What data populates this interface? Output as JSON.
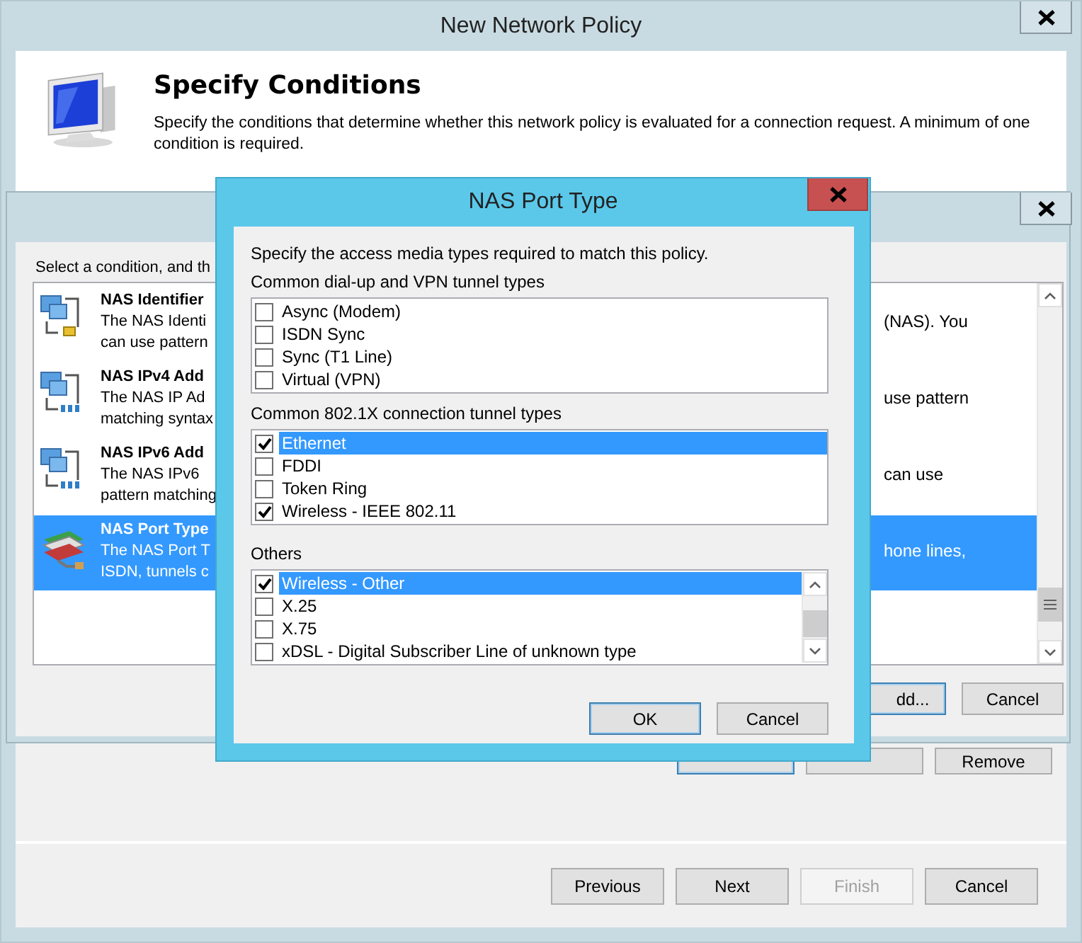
{
  "main_window": {
    "title": "New Network Policy",
    "heading": "Specify Conditions",
    "description": "Specify the conditions that determine whether this network policy is evaluated for a connection request. A minimum of one condition is required.",
    "condition_buttons": [
      {
        "disabled": false
      },
      {
        "disabled": false
      },
      {
        "label": "Remove",
        "disabled": false
      }
    ],
    "nav_buttons": [
      {
        "label": "Previous",
        "disabled": false
      },
      {
        "label": "Next",
        "disabled": false
      },
      {
        "label": "Finish",
        "disabled": true
      },
      {
        "label": "Cancel",
        "disabled": false
      }
    ]
  },
  "condition_window": {
    "prompt": "Select a condition, and th",
    "conditions": [
      {
        "title": "NAS Identifier",
        "lines": [
          "The NAS Identi",
          "can use pattern"
        ],
        "tail": "(NAS). You",
        "selected": false
      },
      {
        "title": "NAS IPv4 Add",
        "lines": [
          "The NAS IP Ad",
          "matching syntax"
        ],
        "tail": "use pattern",
        "selected": false
      },
      {
        "title": "NAS IPv6 Add",
        "lines": [
          "The NAS IPv6",
          "pattern matching"
        ],
        "tail": "can use",
        "selected": false
      },
      {
        "title": "NAS Port Type",
        "lines": [
          "The NAS Port T",
          "ISDN, tunnels c"
        ],
        "tail": "hone lines,",
        "selected": true
      }
    ],
    "buttons": [
      {
        "label": "dd...",
        "default": true
      },
      {
        "label": "Cancel",
        "default": false
      }
    ]
  },
  "port_dialog": {
    "title": "NAS Port Type",
    "instructions": "Specify the access media types required to match this policy.",
    "groups": [
      {
        "label": "Common dial-up and VPN tunnel types",
        "kind": "plain",
        "items": [
          {
            "label": "Async (Modem)",
            "checked": false,
            "selected": false
          },
          {
            "label": "ISDN Sync",
            "checked": false,
            "selected": false
          },
          {
            "label": "Sync (T1 Line)",
            "checked": false,
            "selected": false
          },
          {
            "label": "Virtual (VPN)",
            "checked": false,
            "selected": false
          }
        ]
      },
      {
        "label": "Common 802.1X connection tunnel types",
        "kind": "plain",
        "items": [
          {
            "label": "Ethernet",
            "checked": true,
            "selected": true
          },
          {
            "label": "FDDI",
            "checked": false,
            "selected": false
          },
          {
            "label": "Token Ring",
            "checked": false,
            "selected": false
          },
          {
            "label": "Wireless - IEEE 802.11",
            "checked": true,
            "selected": false
          }
        ]
      },
      {
        "label": "Others",
        "kind": "scrolling",
        "items": [
          {
            "label": "Wireless - Other",
            "checked": true,
            "selected": true
          },
          {
            "label": "X.25",
            "checked": false,
            "selected": false
          },
          {
            "label": "X.75",
            "checked": false,
            "selected": false
          },
          {
            "label": "xDSL - Digital Subscriber Line of unknown type",
            "checked": false,
            "selected": false
          }
        ]
      }
    ],
    "buttons": [
      {
        "label": "OK",
        "default": true
      },
      {
        "label": "Cancel",
        "default": false
      }
    ]
  }
}
